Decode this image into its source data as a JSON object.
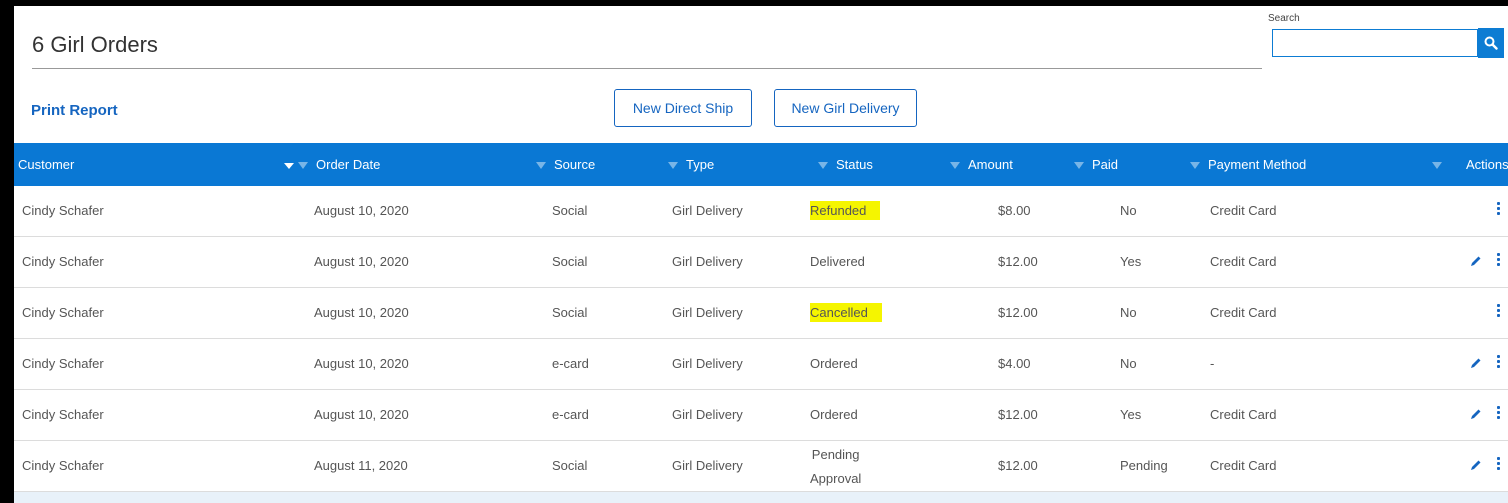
{
  "page": {
    "title": "6 Girl Orders",
    "print_report": "Print Report",
    "new_direct_ship": "New Direct Ship",
    "new_girl_delivery": "New Girl Delivery"
  },
  "search": {
    "label": "Search",
    "value": "",
    "placeholder": "",
    "icon": "search-icon"
  },
  "colors": {
    "accent": "#0a78d4",
    "link": "#1565c0",
    "highlight": "#f5f500"
  },
  "table": {
    "columns": [
      "Customer",
      "Order Date",
      "Source",
      "Type",
      "Status",
      "Amount",
      "Paid",
      "Payment Method",
      "Actions"
    ],
    "rows": [
      {
        "customer": "Cindy Schafer",
        "date": "August 10, 2020",
        "source": "Social",
        "type": "Girl Delivery",
        "status": "Refunded",
        "amount": "$8.00",
        "paid": "No",
        "method": "Credit Card"
      },
      {
        "customer": "Cindy Schafer",
        "date": "August 10, 2020",
        "source": "Social",
        "type": "Girl Delivery",
        "status": "Delivered",
        "amount": "$12.00",
        "paid": "Yes",
        "method": "Credit Card"
      },
      {
        "customer": "Cindy Schafer",
        "date": "August 10, 2020",
        "source": "Social",
        "type": "Girl Delivery",
        "status": "Cancelled",
        "amount": "$12.00",
        "paid": "No",
        "method": "Credit Card"
      },
      {
        "customer": "Cindy Schafer",
        "date": "August 10, 2020",
        "source": "e-card",
        "type": "Girl Delivery",
        "status": "Ordered",
        "amount": "$4.00",
        "paid": "No",
        "method": "-"
      },
      {
        "customer": "Cindy Schafer",
        "date": "August 10, 2020",
        "source": "e-card",
        "type": "Girl Delivery",
        "status": "Ordered",
        "amount": "$12.00",
        "paid": "Yes",
        "method": "Credit Card"
      },
      {
        "customer": "Cindy Schafer",
        "date": "August 11, 2020",
        "source": "Social",
        "type": "Girl Delivery",
        "status_line1": "Pending",
        "status_line2": "Approval",
        "amount": "$12.00",
        "paid": "Pending",
        "method": "Credit Card"
      }
    ]
  }
}
